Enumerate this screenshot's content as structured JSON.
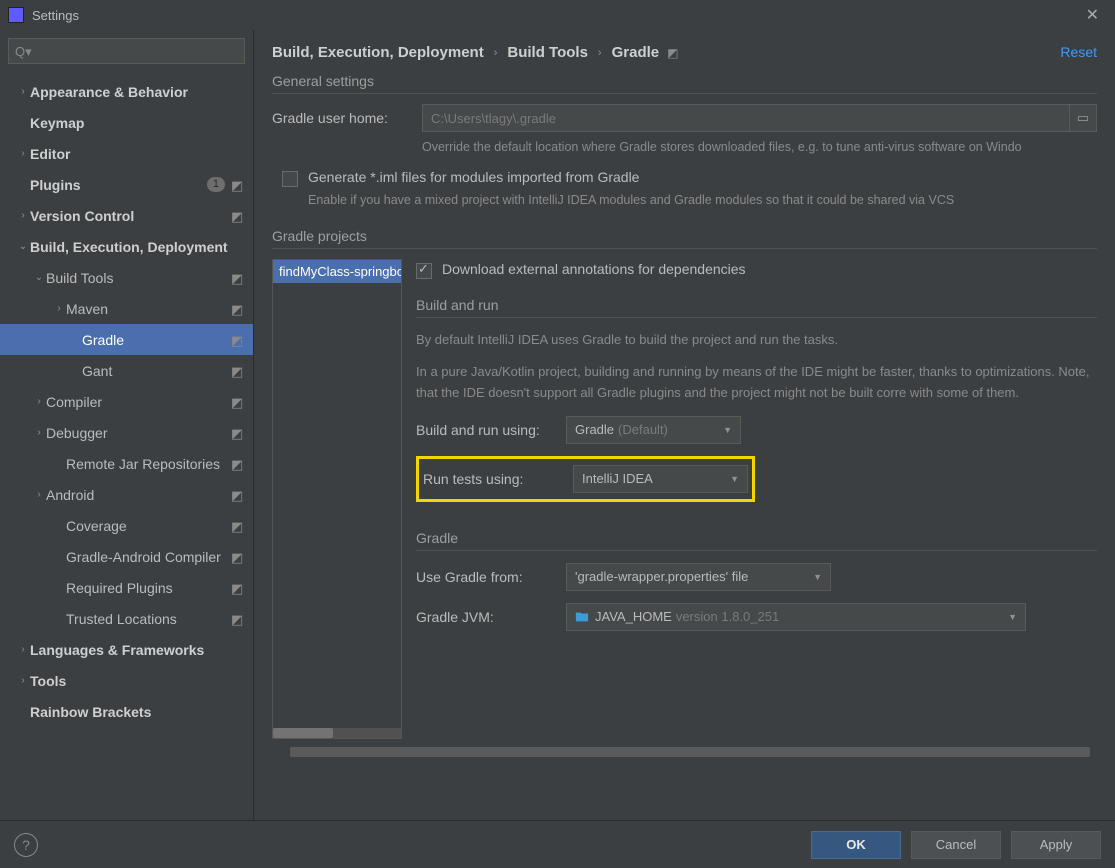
{
  "title": "Settings",
  "search_placeholder": "Q▾",
  "sidebar": {
    "items": [
      {
        "label": "Appearance & Behavior",
        "bold": true,
        "chev": "›",
        "indent": 1
      },
      {
        "label": "Keymap",
        "bold": true,
        "indent": 1
      },
      {
        "label": "Editor",
        "bold": true,
        "chev": "›",
        "indent": 1
      },
      {
        "label": "Plugins",
        "bold": true,
        "indent": 1,
        "badge": "1",
        "cfg": true
      },
      {
        "label": "Version Control",
        "bold": true,
        "chev": "›",
        "indent": 1,
        "cfg": true
      },
      {
        "label": "Build, Execution, Deployment",
        "bold": true,
        "chev": "⌄",
        "indent": 1
      },
      {
        "label": "Build Tools",
        "chev": "⌄",
        "indent": 2,
        "cfg": true
      },
      {
        "label": "Maven",
        "chev": "›",
        "indent": 3,
        "cfg": true
      },
      {
        "label": "Gradle",
        "indent": 4,
        "cfg": true,
        "selected": true
      },
      {
        "label": "Gant",
        "indent": 4,
        "cfg": true
      },
      {
        "label": "Compiler",
        "chev": "›",
        "indent": 2,
        "cfg": true
      },
      {
        "label": "Debugger",
        "chev": "›",
        "indent": 2,
        "cfg": true
      },
      {
        "label": "Remote Jar Repositories",
        "indent": 3,
        "cfg": true
      },
      {
        "label": "Android",
        "chev": "›",
        "indent": 2,
        "cfg": true
      },
      {
        "label": "Coverage",
        "indent": 3,
        "cfg": true
      },
      {
        "label": "Gradle-Android Compiler",
        "indent": 3,
        "cfg": true
      },
      {
        "label": "Required Plugins",
        "indent": 3,
        "cfg": true
      },
      {
        "label": "Trusted Locations",
        "indent": 3,
        "cfg": true
      },
      {
        "label": "Languages & Frameworks",
        "bold": true,
        "chev": "›",
        "indent": 1
      },
      {
        "label": "Tools",
        "bold": true,
        "chev": "›",
        "indent": 1
      },
      {
        "label": "Rainbow Brackets",
        "bold": true,
        "indent": 1
      }
    ]
  },
  "breadcrumb": {
    "a": "Build, Execution, Deployment",
    "b": "Build Tools",
    "c": "Gradle"
  },
  "reset": "Reset",
  "general": {
    "title": "General settings",
    "user_home_label": "Gradle user home:",
    "user_home_placeholder": "C:\\Users\\tlagy\\.gradle",
    "user_home_hint": "Override the default location where Gradle stores downloaded files, e.g. to tune anti-virus software on Windo",
    "iml_label": "Generate *.iml files for modules imported from Gradle",
    "iml_hint": "Enable if you have a mixed project with IntelliJ IDEA modules and Gradle modules so that it could be shared via VCS"
  },
  "projects": {
    "title": "Gradle projects",
    "list": [
      "findMyClass-springboot"
    ],
    "download_annotations": "Download external annotations for dependencies",
    "build_run_title": "Build and run",
    "build_run_desc1": "By default IntelliJ IDEA uses Gradle to build the project and run the tasks.",
    "build_run_desc2": "In a pure Java/Kotlin project, building and running by means of the IDE might be faster, thanks to optimizations. Note, that the IDE doesn't support all Gradle plugins and the project might not be built corre with some of them.",
    "build_using_label": "Build and run using:",
    "build_using_value": "Gradle",
    "build_using_default": "(Default)",
    "tests_using_label": "Run tests using:",
    "tests_using_value": "IntelliJ IDEA",
    "gradle_title": "Gradle",
    "use_from_label": "Use Gradle from:",
    "use_from_value": "'gradle-wrapper.properties' file",
    "jvm_label": "Gradle JVM:",
    "jvm_value": "JAVA_HOME",
    "jvm_version": "version 1.8.0_251"
  },
  "footer": {
    "ok": "OK",
    "cancel": "Cancel",
    "apply": "Apply"
  }
}
